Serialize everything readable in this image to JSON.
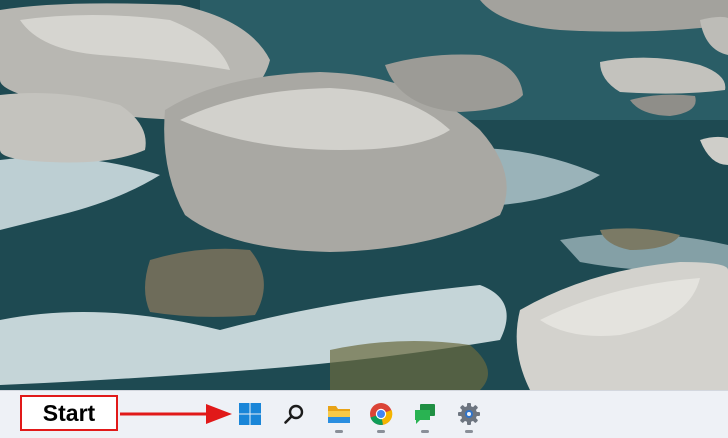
{
  "desktop": {
    "wallpaper": "river-rocks-photo"
  },
  "annotation": {
    "label": "Start",
    "color": "#e11919"
  },
  "taskbar": {
    "background": "#eef1f6",
    "icons": [
      {
        "name": "windows-start-icon",
        "running": false
      },
      {
        "name": "search-icon",
        "running": false
      },
      {
        "name": "file-explorer-icon",
        "running": true
      },
      {
        "name": "chrome-icon",
        "running": true
      },
      {
        "name": "chat-icon",
        "running": true
      },
      {
        "name": "settings-gear-icon",
        "running": true
      }
    ]
  }
}
